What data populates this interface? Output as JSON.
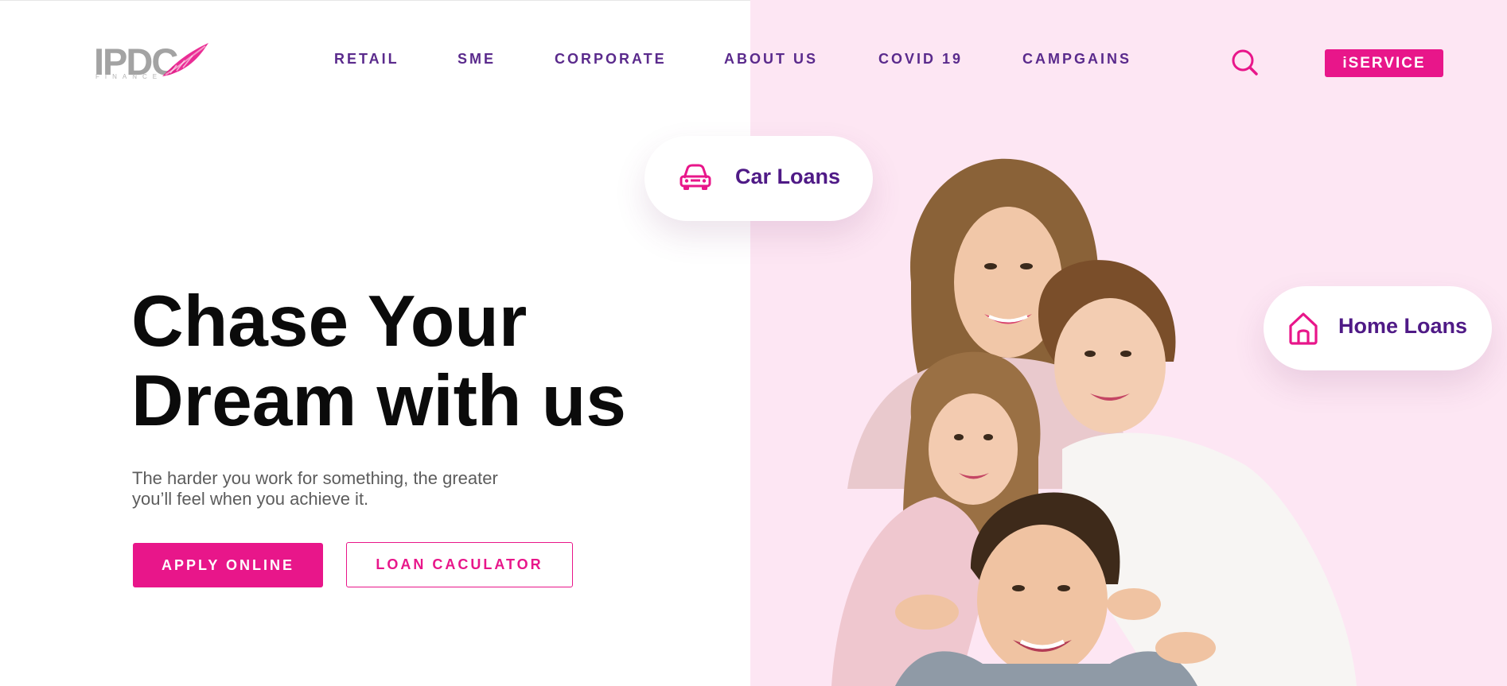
{
  "brand": {
    "logo_text": "IPDC",
    "logo_subtext": "FINANCE",
    "accent_color": "#e8168a",
    "nav_color": "#5a2a8c",
    "panel_color": "#fde6f3"
  },
  "nav": {
    "items": [
      {
        "label": "RETAIL"
      },
      {
        "label": "SME"
      },
      {
        "label": "CORPORATE"
      },
      {
        "label": "ABOUT US"
      },
      {
        "label": "COVID 19"
      },
      {
        "label": "CAMPGAINS"
      }
    ],
    "search_icon": "search-icon",
    "iservice_label": "iSERVICE"
  },
  "hero": {
    "title_line1": "Chase Your",
    "title_line2": "Dream with us",
    "subtitle_line1": "The harder you work for something, the greater",
    "subtitle_line2": "you’ll feel when you achieve it.",
    "apply_label": "APPLY ONLINE",
    "calculator_label": "LOAN CACULATOR"
  },
  "pills": {
    "car": {
      "label": "Car Loans",
      "icon": "car-icon"
    },
    "home": {
      "label": "Home Loans",
      "icon": "home-icon"
    }
  }
}
